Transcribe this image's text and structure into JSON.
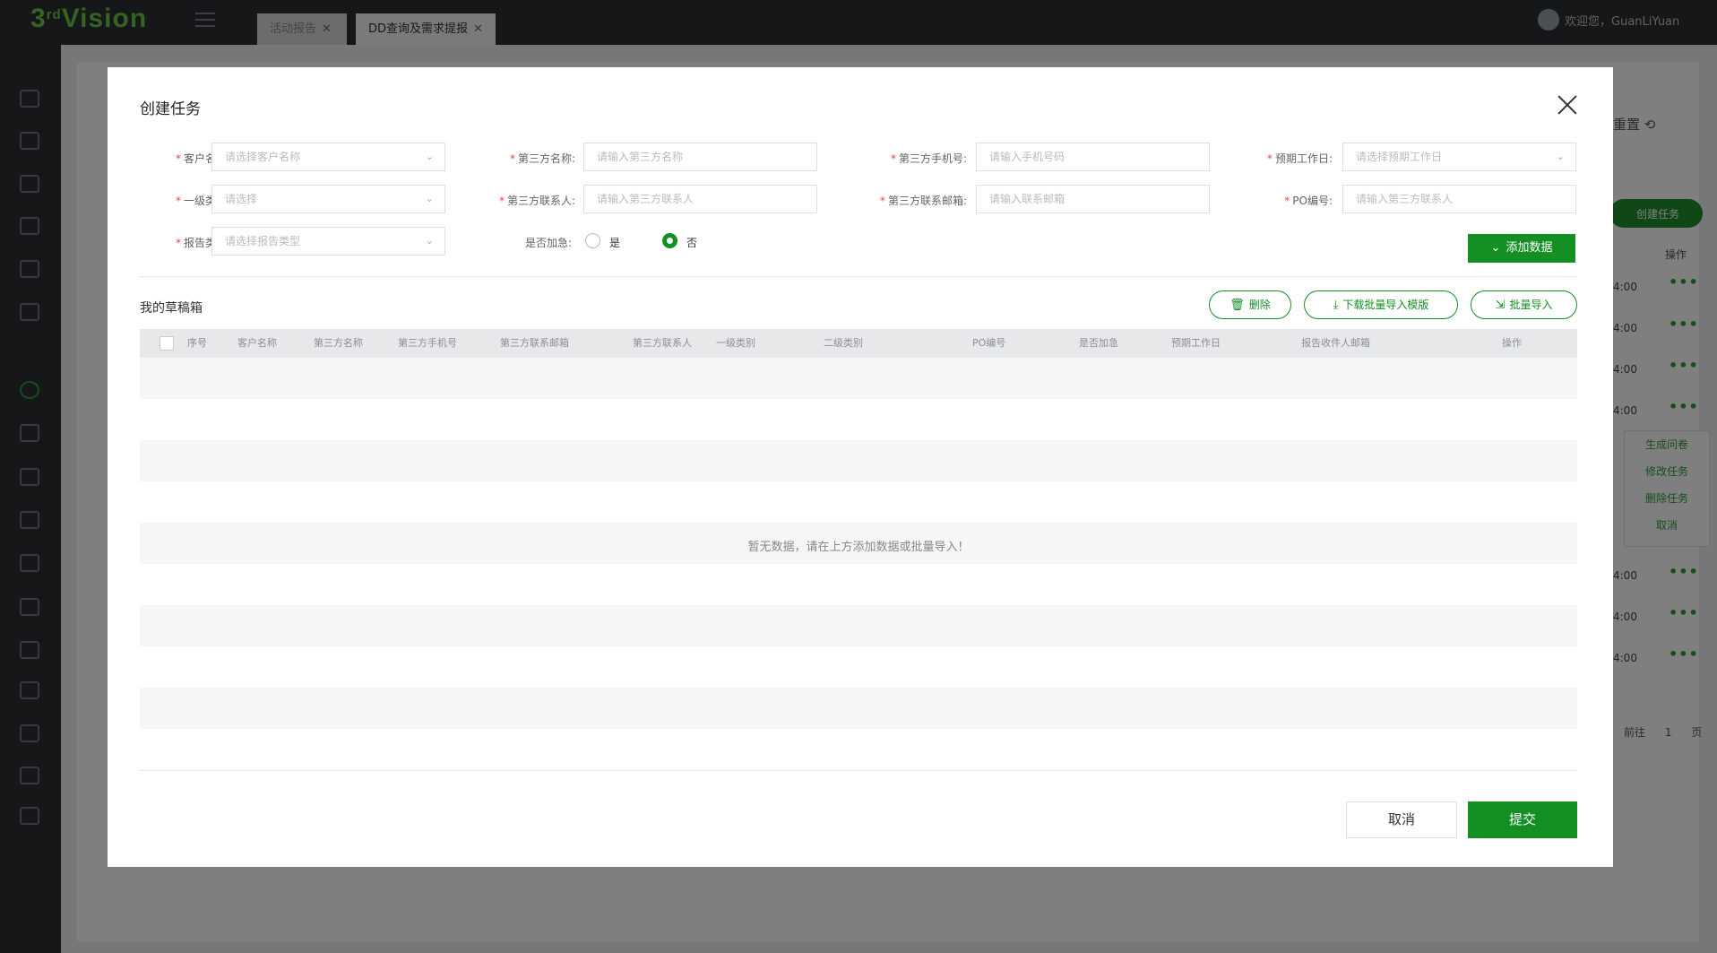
{
  "app": {
    "logo": "3rdVision",
    "logo_main": "3",
    "logo_sup": "rd",
    "logo_rest": "Vision",
    "tabs": [
      {
        "label": "活动报告"
      },
      {
        "label": "DD查询及需求提报"
      }
    ],
    "user_greeting": "欢迎您，GuanLiYuan",
    "bg_reset_label": "重置",
    "bg_create_label": "创建任务",
    "bg_op_header": "操作",
    "bg_times": [
      "4:00",
      "4:00",
      "4:00",
      "4:00",
      "4:00",
      "4:00",
      "4:00"
    ],
    "bg_menu": [
      "生成问卷",
      "修改任务",
      "删除任务",
      "取消"
    ],
    "bg_pager_prev": "前往",
    "bg_pager_page": "1",
    "bg_pager_unit": "页"
  },
  "modal": {
    "title": "创建任务",
    "fields": {
      "customer_name": {
        "label": "客户名称:",
        "placeholder": "请选择客户名称"
      },
      "third_name": {
        "label": "第三方名称:",
        "placeholder": "请输入第三方名称"
      },
      "third_phone": {
        "label": "第三方手机号:",
        "placeholder": "请输入手机号码"
      },
      "due_day": {
        "label": "预期工作日:",
        "placeholder": "请选择预期工作日"
      },
      "level1": {
        "label": "一级类别:",
        "placeholder": "请选择"
      },
      "third_contact": {
        "label": "第三方联系人:",
        "placeholder": "请输入第三方联系人"
      },
      "third_email": {
        "label": "第三方联系邮箱:",
        "placeholder": "请输入联系邮箱"
      },
      "po": {
        "label": "PO编号:",
        "placeholder": "请输入第三方联系人"
      },
      "report_type": {
        "label": "报告类型:",
        "placeholder": "请选择报告类型"
      },
      "urgent": {
        "label": "是否加急:",
        "yes": "是",
        "no": "否",
        "selected": "否"
      }
    },
    "add_button": "添加数据",
    "drafts_title": "我的草稿箱",
    "delete_button": "删除",
    "download_button": "下载批量导入模版",
    "import_button": "批量导入",
    "table_headers": [
      "序号",
      "客户名称",
      "第三方名称",
      "第三方手机号",
      "第三方联系邮箱",
      "第三方联系人",
      "一级类别",
      "二级类别",
      "PO编号",
      "是否加急",
      "预期工作日",
      "报告收件人邮箱",
      "操作"
    ],
    "empty_text": "暂无数据，请在上方添加数据或批量导入！",
    "cancel_button": "取消",
    "submit_button": "提交"
  },
  "colors": {
    "brand_green": "#148f23",
    "logo_green": "#6cc644",
    "required_red": "#e44"
  }
}
